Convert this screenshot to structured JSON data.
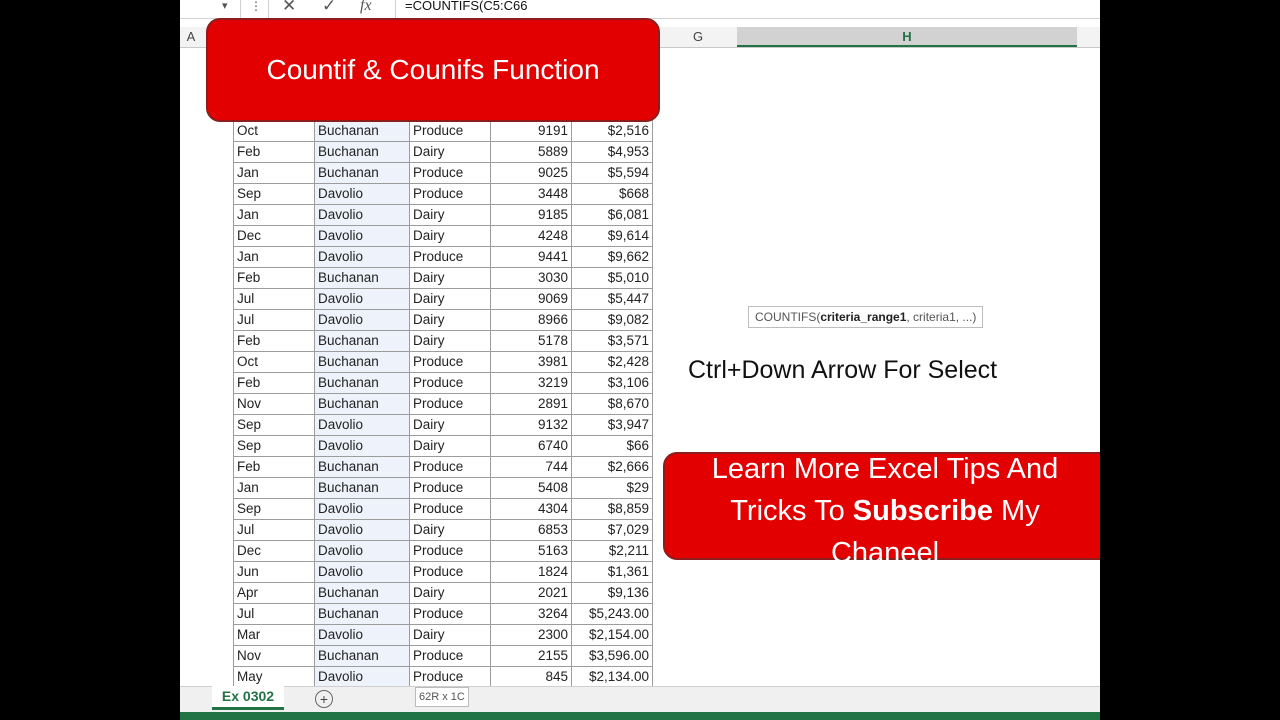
{
  "formula_bar": {
    "formula": "=COUNTIFS(C5:C66"
  },
  "columns": {
    "a": "A",
    "g": "G",
    "h": "H"
  },
  "title_banner": "Countif & Counifs Function",
  "tooltip": {
    "fn": "COUNTIFS(",
    "arg1": "criteria_range1",
    "rest": ", criteria1, ...)"
  },
  "hint": "Ctrl+Down Arrow For Select",
  "subscribe": {
    "line1": "Learn More Excel Tips And",
    "pre": "Tricks To ",
    "bold": "Subscribe",
    "post": " My",
    "line3": "Chaneel"
  },
  "sheet_tab": "Ex 0302",
  "add_sheet": "+",
  "selection_info": "62R x 1C",
  "rows": [
    [
      "Oct",
      "Buchanan",
      "Produce",
      "9191",
      "$2,516"
    ],
    [
      "Feb",
      "Buchanan",
      "Dairy",
      "5889",
      "$4,953"
    ],
    [
      "Jan",
      "Buchanan",
      "Produce",
      "9025",
      "$5,594"
    ],
    [
      "Sep",
      "Davolio",
      "Produce",
      "3448",
      "$668"
    ],
    [
      "Jan",
      "Davolio",
      "Dairy",
      "9185",
      "$6,081"
    ],
    [
      "Dec",
      "Davolio",
      "Dairy",
      "4248",
      "$9,614"
    ],
    [
      "Jan",
      "Davolio",
      "Produce",
      "9441",
      "$9,662"
    ],
    [
      "Feb",
      "Buchanan",
      "Dairy",
      "3030",
      "$5,010"
    ],
    [
      "Jul",
      "Davolio",
      "Dairy",
      "9069",
      "$5,447"
    ],
    [
      "Jul",
      "Davolio",
      "Dairy",
      "8966",
      "$9,082"
    ],
    [
      "Feb",
      "Buchanan",
      "Dairy",
      "5178",
      "$3,571"
    ],
    [
      "Oct",
      "Buchanan",
      "Produce",
      "3981",
      "$2,428"
    ],
    [
      "Feb",
      "Buchanan",
      "Produce",
      "3219",
      "$3,106"
    ],
    [
      "Nov",
      "Buchanan",
      "Produce",
      "2891",
      "$8,670"
    ],
    [
      "Sep",
      "Davolio",
      "Dairy",
      "9132",
      "$3,947"
    ],
    [
      "Sep",
      "Davolio",
      "Dairy",
      "6740",
      "$66"
    ],
    [
      "Feb",
      "Buchanan",
      "Produce",
      "744",
      "$2,666"
    ],
    [
      "Jan",
      "Buchanan",
      "Produce",
      "5408",
      "$29"
    ],
    [
      "Sep",
      "Davolio",
      "Produce",
      "4304",
      "$8,859"
    ],
    [
      "Jul",
      "Davolio",
      "Dairy",
      "6853",
      "$7,029"
    ],
    [
      "Dec",
      "Davolio",
      "Produce",
      "5163",
      "$2,211"
    ],
    [
      "Jun",
      "Davolio",
      "Produce",
      "1824",
      "$1,361"
    ],
    [
      "Apr",
      "Buchanan",
      "Dairy",
      "2021",
      "$9,136"
    ],
    [
      "Jul",
      "Buchanan",
      "Produce",
      "3264",
      "$5,243.00"
    ],
    [
      "Mar",
      "Davolio",
      "Dairy",
      "2300",
      "$2,154.00"
    ],
    [
      "Nov",
      "Buchanan",
      "Produce",
      "2155",
      "$3,596.00"
    ],
    [
      "May",
      "Davolio",
      "Produce",
      "845",
      "$2,134.00"
    ]
  ]
}
